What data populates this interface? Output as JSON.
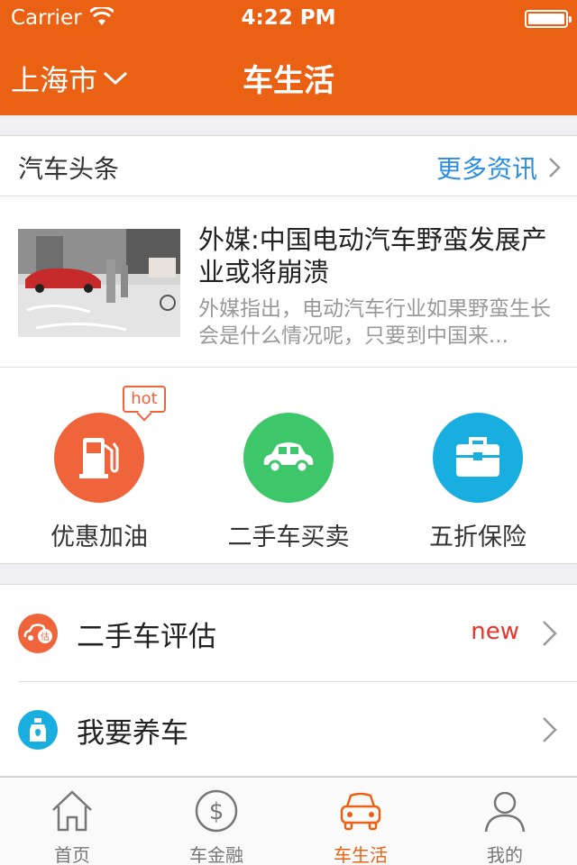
{
  "status_bar": {
    "carrier": "Carrier",
    "time": "4:22 PM"
  },
  "nav": {
    "city": "上海市",
    "title": "车生活"
  },
  "news": {
    "header_title": "汽车头条",
    "more_label": "更多资讯",
    "article": {
      "title": "外媒:中国电动汽车野蛮发展产业或将崩溃",
      "summary": "外媒指出，电动汽车行业如果野蛮生长会是什么情况呢，只要到中国来..."
    }
  },
  "services": [
    {
      "label": "优惠加油",
      "icon": "gas-pump-icon",
      "color": "#f0643c",
      "badge": "hot"
    },
    {
      "label": "二手车买卖",
      "icon": "car-icon",
      "color": "#3dc76a"
    },
    {
      "label": "五折保险",
      "icon": "briefcase-icon",
      "color": "#19aee0"
    }
  ],
  "list": [
    {
      "label": "二手车评估",
      "badge": "new",
      "icon": "car-appraisal-icon",
      "color": "#f0643c"
    },
    {
      "label": "我要养车",
      "icon": "oil-bottle-icon",
      "color": "#19aee0"
    }
  ],
  "tabs": [
    {
      "label": "首页",
      "icon": "home-icon"
    },
    {
      "label": "车金融",
      "icon": "dollar-icon"
    },
    {
      "label": "车生活",
      "icon": "car-front-icon",
      "active": true
    },
    {
      "label": "我的",
      "icon": "user-icon"
    }
  ],
  "colors": {
    "brand": "#ea6114",
    "link": "#2b8de3",
    "badge_red": "#e8342a"
  }
}
